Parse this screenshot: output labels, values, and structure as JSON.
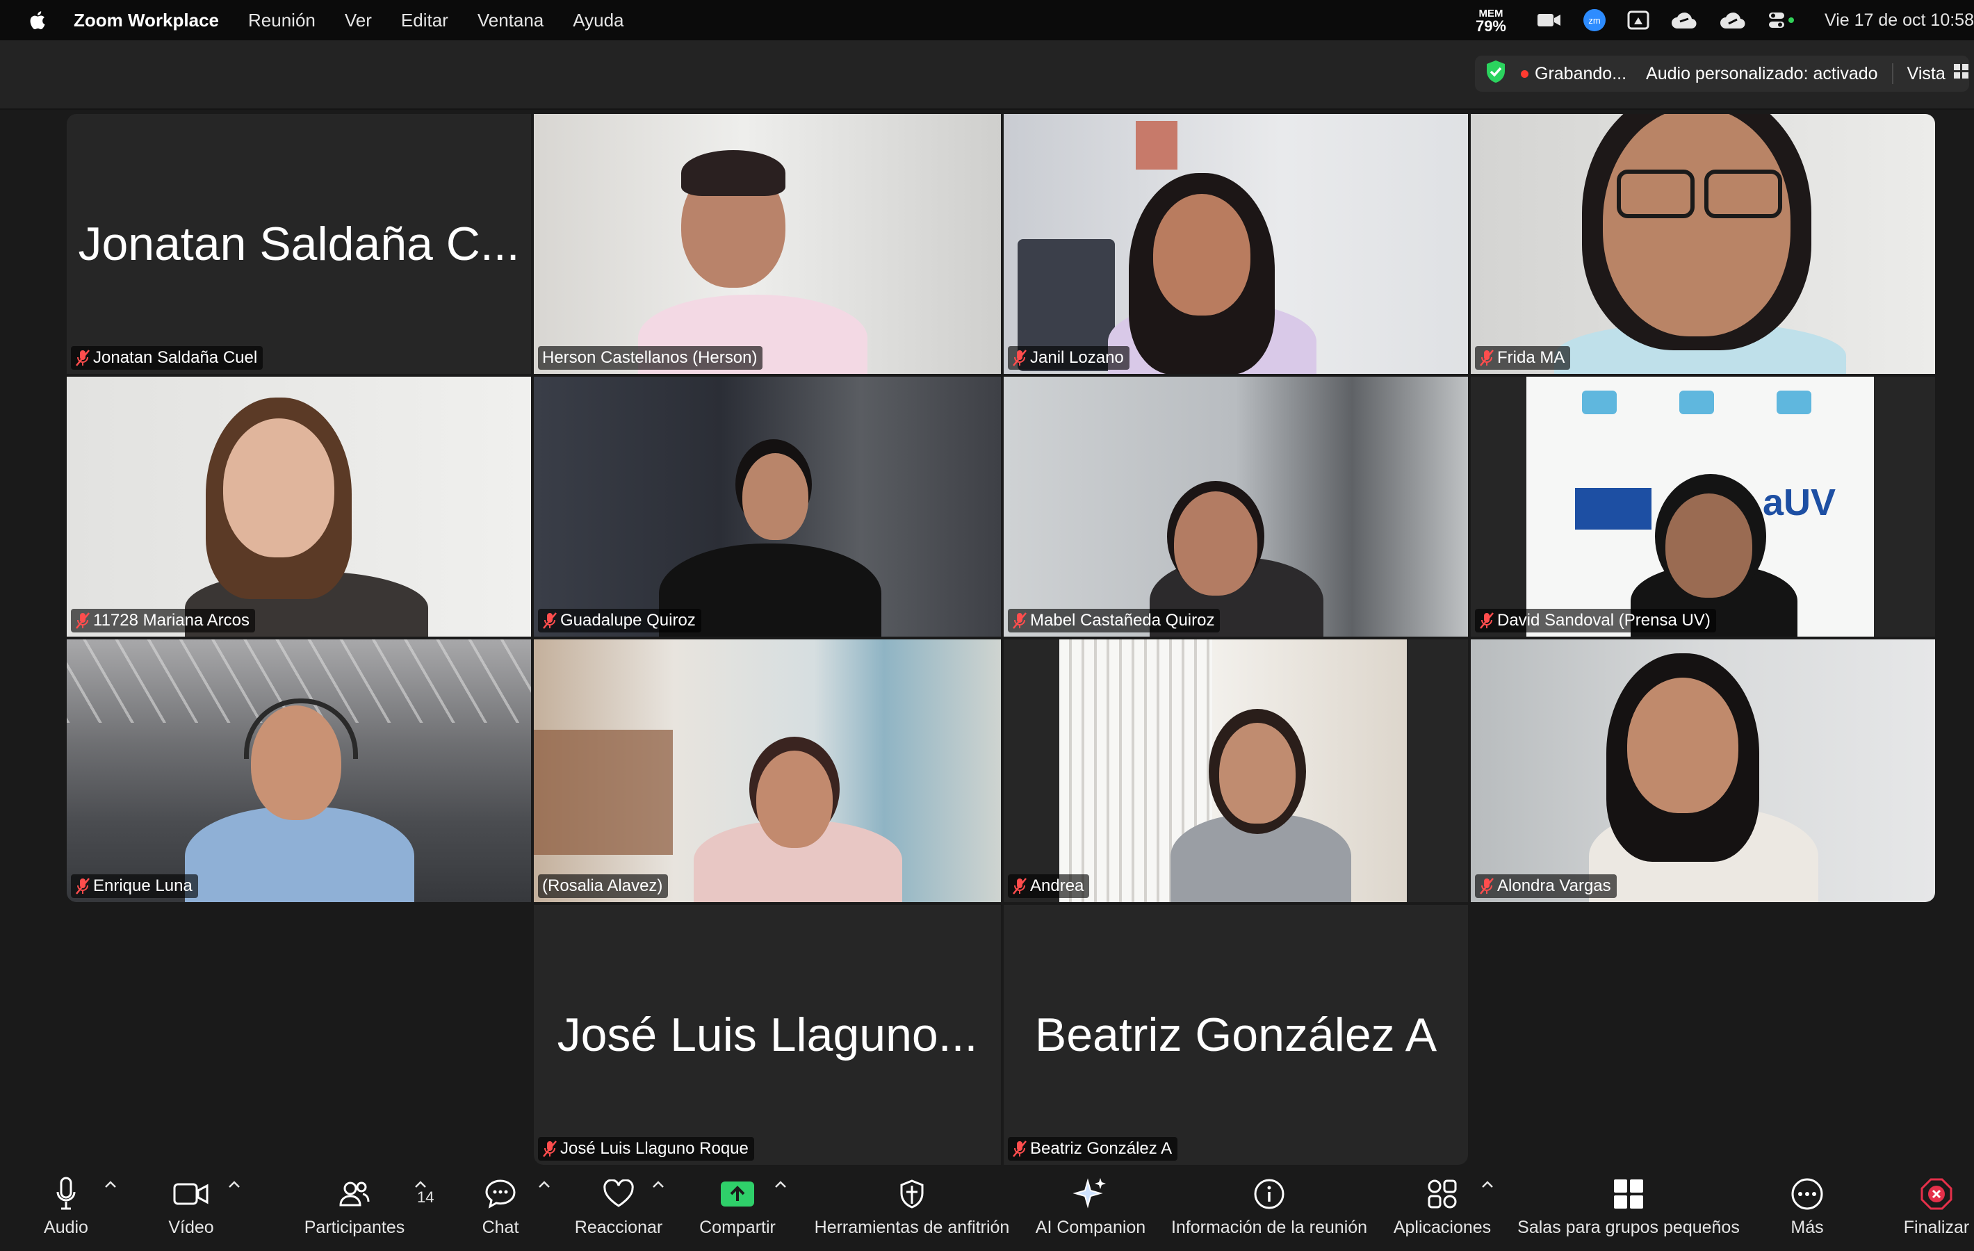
{
  "menubar": {
    "app_name": "Zoom Workplace",
    "menus": [
      "Reunión",
      "Ver",
      "Editar",
      "Ventana",
      "Ayuda"
    ],
    "memory_label": "MEM",
    "memory_value": "79%",
    "clock": "Vie 17 de oct  10:58"
  },
  "topbar": {
    "recording_label": "Grabando...",
    "audio_label": "Audio personalizado: activado",
    "view_label": "Vista"
  },
  "participants": [
    {
      "name": "Jonatan Saldaña Cuel",
      "display_name": "Jonatan Saldaña C...",
      "video": false,
      "muted": true
    },
    {
      "name": "Herson Castellanos (Herson)",
      "video": true,
      "muted": false,
      "active_speaker": true
    },
    {
      "name": "Janil Lozano",
      "video": true,
      "muted": true
    },
    {
      "name": "Frida MA",
      "video": true,
      "muted": true
    },
    {
      "name": "11728 Mariana Arcos",
      "video": true,
      "muted": true
    },
    {
      "name": "Guadalupe Quiroz",
      "video": true,
      "muted": true
    },
    {
      "name": "Mabel Castañeda Quiroz",
      "video": true,
      "muted": true
    },
    {
      "name": "David Sandoval (Prensa UV)",
      "video": true,
      "muted": true
    },
    {
      "name": "Enrique Luna",
      "video": true,
      "muted": true
    },
    {
      "name": "(Rosalia Alavez)",
      "video": true,
      "muted": false
    },
    {
      "name": "Andrea",
      "video": true,
      "muted": true
    },
    {
      "name": "Alondra Vargas",
      "video": true,
      "muted": true
    },
    {
      "name": "José Luis Llaguno Roque",
      "display_name": "José Luis Llaguno...",
      "video": false,
      "muted": true
    },
    {
      "name": "Beatriz González A",
      "display_name": "Beatriz González A",
      "video": false,
      "muted": true
    }
  ],
  "backdrop_text": "aUV",
  "toolbar": {
    "audio": "Audio",
    "video": "Vídeo",
    "participants": "Participantes",
    "participants_count": "14",
    "chat": "Chat",
    "react": "Reaccionar",
    "share": "Compartir",
    "host_tools": "Herramientas de anfitrión",
    "ai_companion": "AI Companion",
    "meeting_info": "Información de la reunión",
    "apps": "Aplicaciones",
    "breakout": "Salas para grupos pequeños",
    "more": "Más",
    "end": "Finalizar"
  },
  "colors": {
    "active_speaker": "#3fc74e",
    "share_button": "#2fd06a",
    "end_button": "#e5304a",
    "muted_icon": "#ff4d4d",
    "recording_dot": "#ff3b30",
    "shield": "#2bd35e"
  }
}
